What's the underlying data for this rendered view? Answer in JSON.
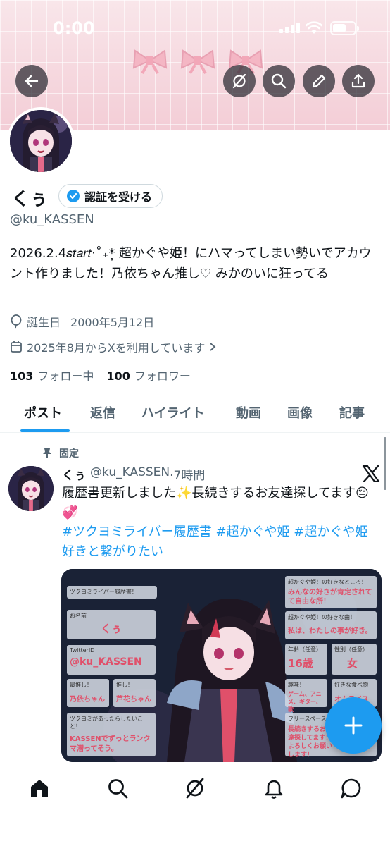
{
  "status_bar": {
    "time": "0:00"
  },
  "profile": {
    "display_name": "くぅ",
    "verify_button_label": "認証を受ける",
    "handle": "@ku_KASSEN",
    "bio": "2026.2.4𝑠𝑡𝑎𝑟𝑡‧˚₊*̥ 超かぐや姫！にハマってしまい勢いでアカウント作りました！乃依ちゃん推し♡ みかのいに狂ってる",
    "birthday_label": "誕生日",
    "birthday": "2000年5月12日",
    "joined": "2025年8月からXを利用しています",
    "following_count": "103",
    "following_label": "フォロー中",
    "followers_count": "100",
    "followers_label": "フォロワー"
  },
  "tabs": [
    {
      "label": "ポスト",
      "active": true
    },
    {
      "label": "返信"
    },
    {
      "label": "ハイライト"
    },
    {
      "label": "動画"
    },
    {
      "label": "画像"
    },
    {
      "label": "記事"
    }
  ],
  "post": {
    "pinned_label": "固定",
    "author_name": "くぅ",
    "author_handle": "@ku_KASSEN",
    "time": "·7時間",
    "text": "履歴書更新しました✨長続きするお友達探してます😔💞",
    "hashtags": "#ツクヨミライバー履歴書 #超かぐや姫 #超かぐや姫好きと繋がりたい",
    "media": {
      "title": "ツクヨミライバー履歴書！",
      "name_label": "お名前",
      "name_value": "くぅ",
      "twitter_label": "TwitterID",
      "twitter_value": "@ku_KASSEN",
      "oshi_label": "最推し！",
      "oshi_value": "乃依ちゃん",
      "oshi2_label": "推し！",
      "oshi2_value": "芦花ちゃん",
      "tsukuyomi_label": "ツクヨミがあったらしたいこと！",
      "tsukuyomi_value": "KASSENでずっとランクマ潜ってそう。",
      "like_point_label": "超かぐや姫！の好きなところ！",
      "like_point_value": "みんなの好きが肯定されてて自由な所！",
      "fav_song_label": "超かぐや姫！の好きな曲！",
      "fav_song_value": "私は、わたしの事が好き。",
      "age_label": "年齢（任意）",
      "age_value": "16歳",
      "gender_label": "性別（任意）",
      "gender_value": "女",
      "hobby_label": "趣味！",
      "hobby_value": "ゲーム、アニメ、ギター、歌",
      "food_label": "好きな食べ物",
      "food_value": "オムライス",
      "free_label": "フリースペース",
      "free_value": "長続きするお友達探してます！よろしくお願いします！"
    }
  },
  "colors": {
    "accent": "#1d9bf0",
    "banner_pink": "#f7dce2",
    "text_secondary": "#536471"
  }
}
